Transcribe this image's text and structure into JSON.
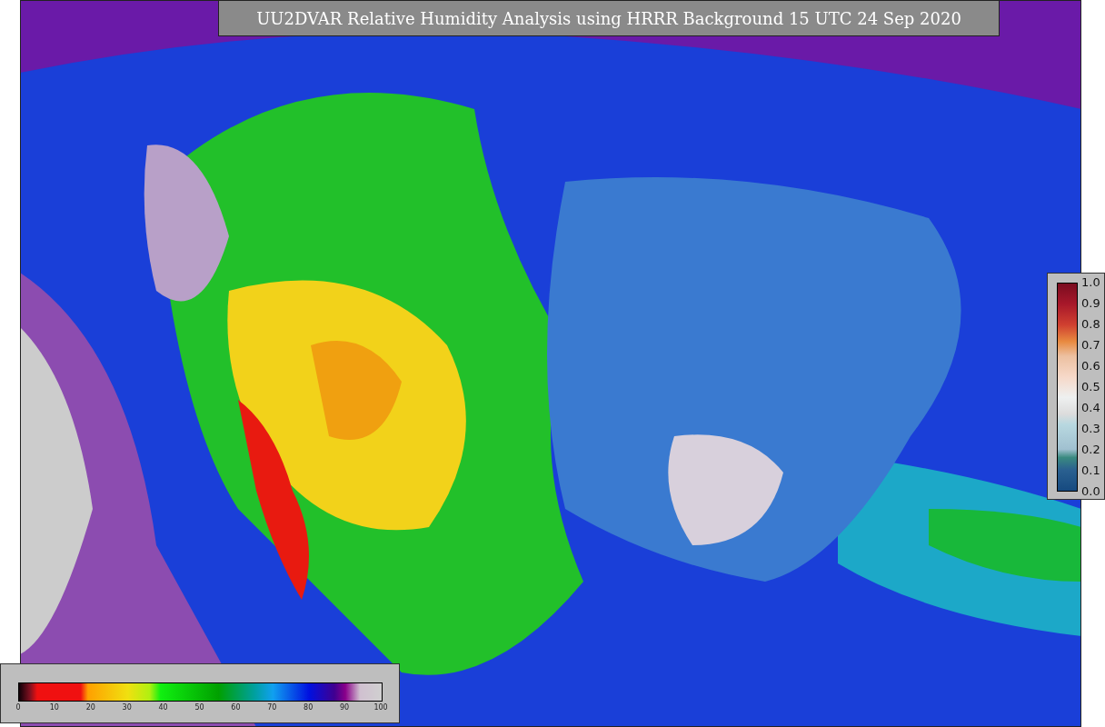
{
  "title": "UU2DVAR Relative Humidity Analysis using HRRR Background 15 UTC 24 Sep 2020",
  "vertical_colorbar": {
    "ticks": [
      "1.0",
      "0.9",
      "0.8",
      "0.7",
      "0.6",
      "0.5",
      "0.4",
      "0.3",
      "0.2",
      "0.1",
      "0.0"
    ]
  },
  "horizontal_colorbar": {
    "ticks": [
      "0",
      "10",
      "20",
      "30",
      "40",
      "50",
      "60",
      "70",
      "80",
      "90",
      "100"
    ]
  }
}
